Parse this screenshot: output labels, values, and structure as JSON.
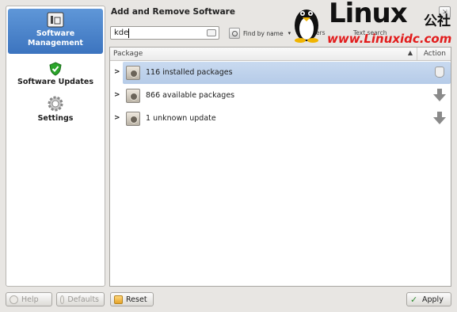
{
  "window": {
    "title": "Add and Remove Software"
  },
  "sidebar": {
    "items": [
      {
        "label": "Software Management",
        "icon": "software-management-icon",
        "active": true
      },
      {
        "label": "Software Updates",
        "icon": "shield-check-icon",
        "active": false
      },
      {
        "label": "Settings",
        "icon": "gear-icon",
        "active": false
      }
    ]
  },
  "search": {
    "value": "kde",
    "placeholder": ""
  },
  "filter": {
    "find_by_label": "Find by name",
    "extra_text": "ters",
    "text_search_label": "Text search"
  },
  "table": {
    "columns": [
      "Package",
      "Action"
    ],
    "rows": [
      {
        "label": "116 installed packages",
        "action_icon": "remove-icon",
        "selected": true
      },
      {
        "label": "866 available packages",
        "action_icon": "install-arrow-icon",
        "selected": false
      },
      {
        "label": "1 unknown update",
        "action_icon": "install-arrow-icon",
        "selected": false
      }
    ]
  },
  "buttons": {
    "help": "Help",
    "defaults": "Defaults",
    "reset": "Reset",
    "apply": "Apply"
  },
  "watermark": {
    "logo": "Linux",
    "cn": "公社",
    "url": "www.Linuxidc.com"
  },
  "colors": {
    "accent": "#4a82cc",
    "selection": "#c2d5ee",
    "watermark_url": "#e21c1c"
  }
}
